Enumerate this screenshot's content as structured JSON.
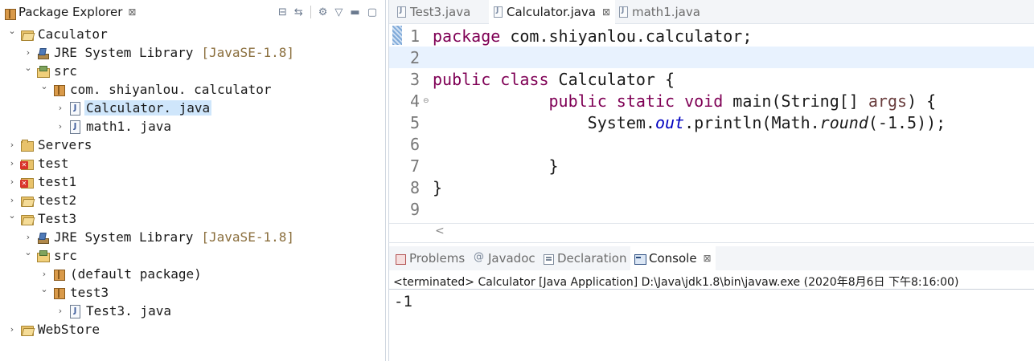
{
  "explorer": {
    "title": "Package Explorer",
    "close_glyph": "⊠",
    "tools": [
      "collapse-all-icon",
      "link-with-editor-icon",
      "filters-icon",
      "view-menu-icon",
      "minimize-icon",
      "maximize-icon"
    ],
    "tree": [
      {
        "depth": 0,
        "expanded": true,
        "icon": "project-icon",
        "label": "Caculator",
        "decor": ""
      },
      {
        "depth": 1,
        "expanded": false,
        "icon": "library-icon",
        "label": "JRE System Library",
        "decor": "[JavaSE-1.8]"
      },
      {
        "depth": 1,
        "expanded": true,
        "icon": "source-folder-icon",
        "label": "src",
        "decor": ""
      },
      {
        "depth": 2,
        "expanded": true,
        "icon": "package-icon",
        "label": "com. shiyanlou. calculator",
        "decor": ""
      },
      {
        "depth": 3,
        "expanded": false,
        "icon": "java-file-icon",
        "label": "Calculator. java",
        "decor": "",
        "selected": true
      },
      {
        "depth": 3,
        "expanded": false,
        "icon": "java-file-icon",
        "label": "math1. java",
        "decor": ""
      },
      {
        "depth": 0,
        "expanded": false,
        "icon": "folder-icon",
        "label": "Servers",
        "decor": ""
      },
      {
        "depth": 0,
        "expanded": false,
        "icon": "error-project-icon",
        "label": "test",
        "decor": ""
      },
      {
        "depth": 0,
        "expanded": false,
        "icon": "error-project-icon",
        "label": "test1",
        "decor": ""
      },
      {
        "depth": 0,
        "expanded": false,
        "icon": "project-icon",
        "label": "test2",
        "decor": ""
      },
      {
        "depth": 0,
        "expanded": true,
        "icon": "project-icon",
        "label": "Test3",
        "decor": ""
      },
      {
        "depth": 1,
        "expanded": false,
        "icon": "library-icon",
        "label": "JRE System Library",
        "decor": "[JavaSE-1.8]"
      },
      {
        "depth": 1,
        "expanded": true,
        "icon": "source-folder-icon",
        "label": "src",
        "decor": ""
      },
      {
        "depth": 2,
        "expanded": false,
        "icon": "package-icon",
        "label": "(default package)",
        "decor": ""
      },
      {
        "depth": 2,
        "expanded": true,
        "icon": "package-icon",
        "label": "test3",
        "decor": ""
      },
      {
        "depth": 3,
        "expanded": false,
        "icon": "java-file-icon",
        "label": "Test3. java",
        "decor": ""
      },
      {
        "depth": 0,
        "expanded": false,
        "icon": "project-icon",
        "label": "WebStore",
        "decor": ""
      }
    ]
  },
  "editor": {
    "tabs": [
      {
        "label": "Test3.java",
        "active": false
      },
      {
        "label": "Calculator.java",
        "active": true
      },
      {
        "label": "math1.java",
        "active": false
      }
    ],
    "tab_close_glyph": "⊠",
    "current_line": 2,
    "lines": [
      {
        "n": "1",
        "fold": "",
        "tokens": [
          {
            "t": "package",
            "c": "kw"
          },
          {
            "t": " com.shiyanlou.calculator;",
            "c": ""
          }
        ]
      },
      {
        "n": "2",
        "fold": "",
        "tokens": []
      },
      {
        "n": "3",
        "fold": "",
        "tokens": [
          {
            "t": "public",
            "c": "kw"
          },
          {
            "t": " ",
            "c": ""
          },
          {
            "t": "class",
            "c": "kw"
          },
          {
            "t": " Calculator {",
            "c": ""
          }
        ]
      },
      {
        "n": "4",
        "fold": "⊖",
        "tokens": [
          {
            "t": "            ",
            "c": ""
          },
          {
            "t": "public",
            "c": "kw"
          },
          {
            "t": " ",
            "c": ""
          },
          {
            "t": "static",
            "c": "kw"
          },
          {
            "t": " ",
            "c": ""
          },
          {
            "t": "void",
            "c": "kw"
          },
          {
            "t": " main(String[] ",
            "c": ""
          },
          {
            "t": "args",
            "c": "param"
          },
          {
            "t": ") {",
            "c": ""
          }
        ]
      },
      {
        "n": "5",
        "fold": "",
        "tokens": [
          {
            "t": "                System.",
            "c": ""
          },
          {
            "t": "out",
            "c": "field"
          },
          {
            "t": ".println(Math.",
            "c": ""
          },
          {
            "t": "round",
            "c": "italic"
          },
          {
            "t": "(-1.5));",
            "c": ""
          }
        ]
      },
      {
        "n": "6",
        "fold": "",
        "tokens": []
      },
      {
        "n": "7",
        "fold": "",
        "tokens": [
          {
            "t": "            }",
            "c": ""
          }
        ]
      },
      {
        "n": "8",
        "fold": "",
        "tokens": [
          {
            "t": "}",
            "c": ""
          }
        ]
      },
      {
        "n": "9",
        "fold": "",
        "tokens": []
      }
    ],
    "scroll_left_glyph": "<"
  },
  "console": {
    "tabs": [
      {
        "label": "Problems",
        "icon": "problems",
        "active": false
      },
      {
        "label": "Javadoc",
        "icon": "javadoc",
        "active": false
      },
      {
        "label": "Declaration",
        "icon": "declaration",
        "active": false
      },
      {
        "label": "Console",
        "icon": "console",
        "active": true
      }
    ],
    "tab_close_glyph": "⊠",
    "status": "<terminated> Calculator [Java Application] D:\\Java\\jdk1.8\\bin\\javaw.exe (2020年8月6日 下午8:16:00)",
    "output": "-1"
  }
}
